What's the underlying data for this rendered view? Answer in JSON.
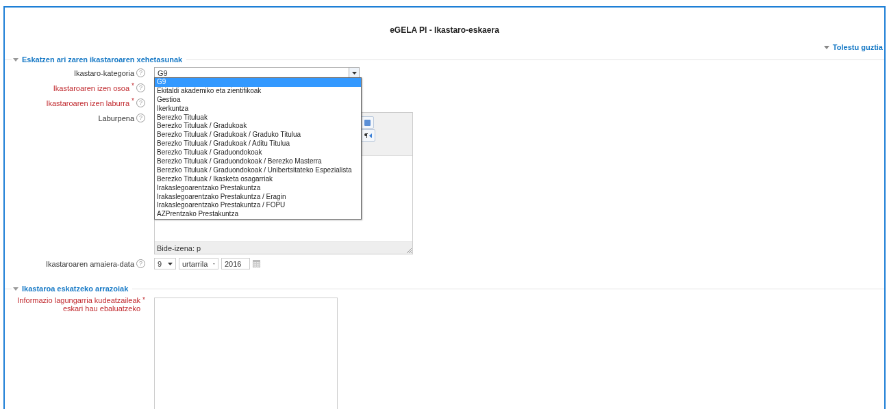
{
  "title": "eGELA PI - Ikastaro-eskaera",
  "collapse_all": "Tolestu guztia",
  "required_mark": "*",
  "sections": [
    {
      "legend": "Eskatzen ari zaren ikastaroaren xehetasunak",
      "expanded": true,
      "fields": [
        {
          "kind": "select",
          "label": "Ikastaro-kategoria",
          "required": false,
          "help": "?",
          "value": "G9",
          "open": true,
          "options": [
            {
              "label": "G9",
              "selected": true
            },
            {
              "label": "Ekitaldi akademiko eta zientifikoak",
              "selected": false
            },
            {
              "label": "Gestioa",
              "selected": false
            },
            {
              "label": "Ikerkuntza",
              "selected": false
            },
            {
              "label": "Berezko Tituluak",
              "selected": false
            },
            {
              "label": "Berezko Tituluak / Gradukoak",
              "selected": false
            },
            {
              "label": "Berezko Tituluak / Gradukoak / Graduko Titulua",
              "selected": false
            },
            {
              "label": "Berezko Tituluak / Gradukoak / Aditu Titulua",
              "selected": false
            },
            {
              "label": "Berezko Tituluak / Graduondokoak",
              "selected": false
            },
            {
              "label": "Berezko Tituluak / Graduondokoak / Berezko Masterra",
              "selected": false
            },
            {
              "label": "Berezko Tituluak / Graduondokoak / Unibertsitateko Espezialista",
              "selected": false
            },
            {
              "label": "Berezko Tituluak / Ikasketa osagarriak",
              "selected": false
            },
            {
              "label": "Irakaslegoarentzako Prestakuntza",
              "selected": false
            },
            {
              "label": "Irakaslegoarentzako Prestakuntza / Eragin",
              "selected": false
            },
            {
              "label": "Irakaslegoarentzako Prestakuntza / FOPU",
              "selected": false
            },
            {
              "label": "AZPrentzako Prestakuntza",
              "selected": false
            }
          ]
        },
        {
          "kind": "text",
          "label": "Ikastaroaren izen osoa",
          "required": true,
          "help": "?"
        },
        {
          "kind": "text",
          "label": "Ikastaroaren izen laburra",
          "required": true,
          "help": "?"
        },
        {
          "kind": "editor",
          "label": "Laburpena",
          "required": false,
          "help": "?",
          "status": "Bide-izena: p"
        },
        {
          "kind": "date",
          "label": "Ikastaroaren amaiera-data",
          "required": false,
          "help": "?",
          "day": "9",
          "month": "urtarrila",
          "year": "2016"
        }
      ]
    },
    {
      "legend": "Ikastaroa eskatzeko arrazoiak",
      "expanded": true,
      "fields": [
        {
          "kind": "textarea",
          "label": "Informazio lagungarria kudeatzaileak eskari hau ebaluatzeko",
          "required": true
        }
      ]
    }
  ]
}
